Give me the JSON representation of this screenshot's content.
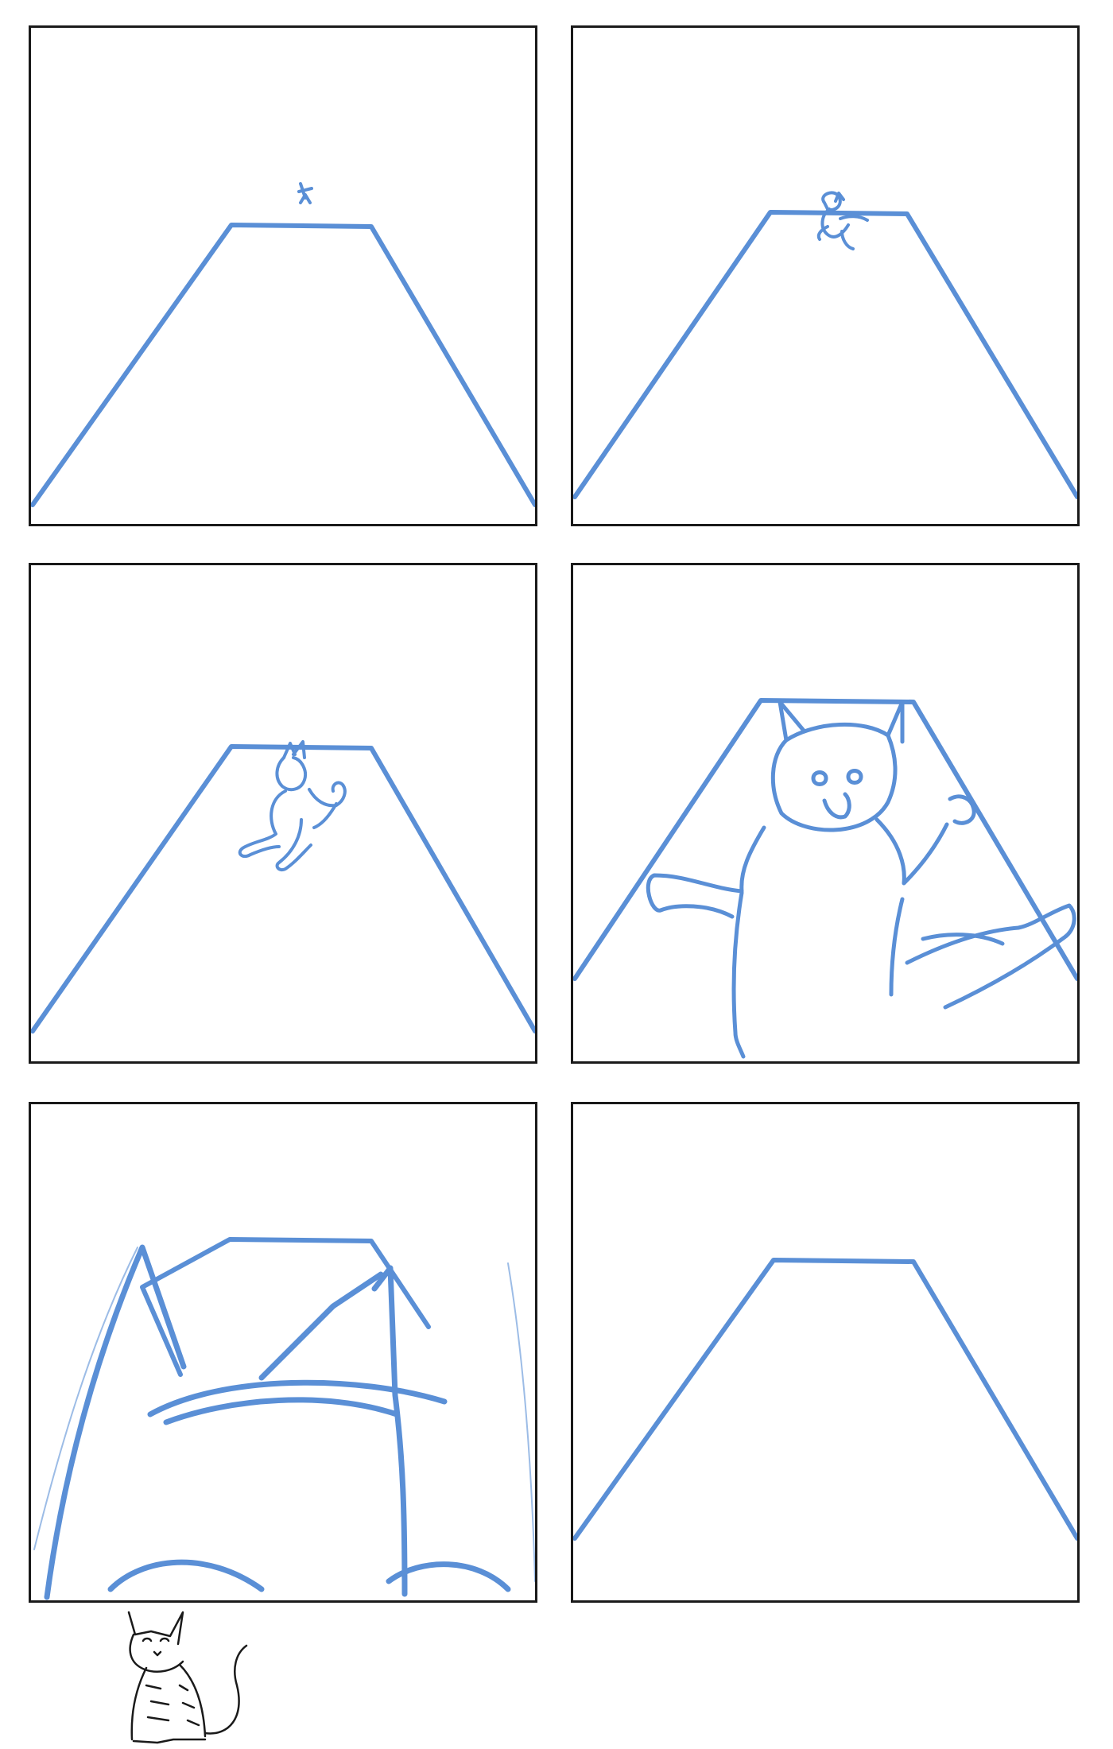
{
  "page": {
    "kind": "storyboard-sketch",
    "sketch_color": "#5a8fd6",
    "border_color": "#1a1a1a",
    "background": "#ffffff"
  },
  "panels": [
    {
      "index": 1,
      "subject": "tiny-figure-far"
    },
    {
      "index": 2,
      "subject": "small-cat-approaching"
    },
    {
      "index": 3,
      "subject": "cat-running"
    },
    {
      "index": 4,
      "subject": "cat-close-arms-out"
    },
    {
      "index": 5,
      "subject": "cat-head-filling-frame"
    },
    {
      "index": 6,
      "subject": "empty-road"
    }
  ],
  "mascot": {
    "icon": "sitting-tabby-cat-icon"
  }
}
